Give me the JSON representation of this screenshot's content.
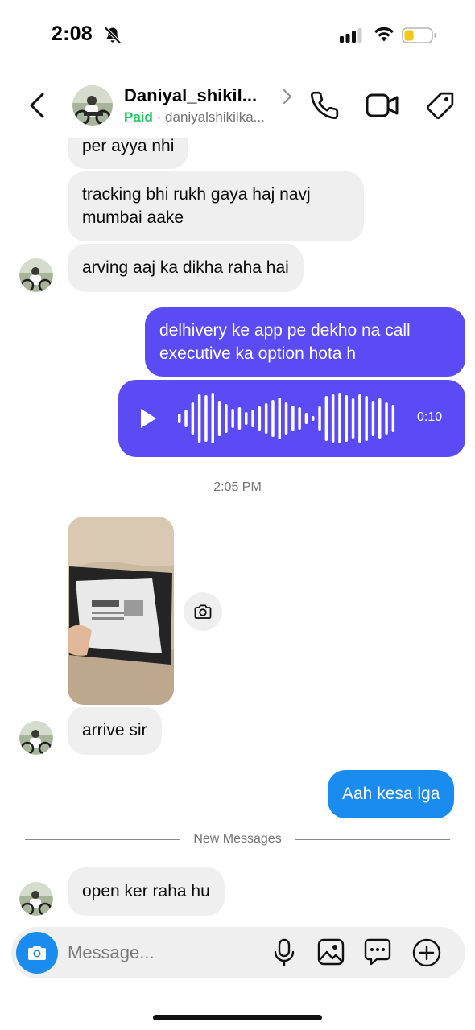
{
  "status_bar": {
    "time": "2:08",
    "icons": [
      "bell-slash-icon",
      "signal-icon",
      "wifi-icon",
      "battery-icon"
    ]
  },
  "header": {
    "name": "Daniyal_shikil...",
    "paid_label": "Paid",
    "separator": "·",
    "username": "daniyalshikilka...",
    "icons": [
      "back-icon",
      "avatar",
      "chevron-right-icon",
      "phone-icon",
      "video-icon",
      "tag-icon"
    ]
  },
  "messages": [
    {
      "side": "in",
      "text": "per ayya nhi"
    },
    {
      "side": "in",
      "lines": [
        "tracking bhi rukh gaya haj navj",
        "mumbai aake"
      ]
    },
    {
      "side": "in",
      "text": "arving aaj ka dikha raha hai"
    },
    {
      "side": "out",
      "lines": [
        "delhivery ke app pe dekho na call",
        "executive ka option hota h"
      ]
    },
    {
      "side": "out",
      "type": "voice",
      "duration": "0:10"
    },
    {
      "side": "in",
      "type": "photo"
    },
    {
      "side": "in",
      "text": "arrive sir"
    },
    {
      "side": "out",
      "text": "Aah kesa lga"
    },
    {
      "side": "in",
      "text": "open ker raha hu"
    }
  ],
  "timestamp": "2:05 PM",
  "divider_label": "New Messages",
  "composer": {
    "placeholder": "Message...",
    "icons": [
      "camera-icon",
      "mic-icon",
      "gallery-icon",
      "sticker-icon",
      "plus-icon"
    ]
  },
  "colors": {
    "outgoing_bubble": "#5b4bf5",
    "outgoing_text_bubble": "#1a8cf0",
    "incoming_bubble": "#efefef",
    "paid": "#22c55e"
  }
}
